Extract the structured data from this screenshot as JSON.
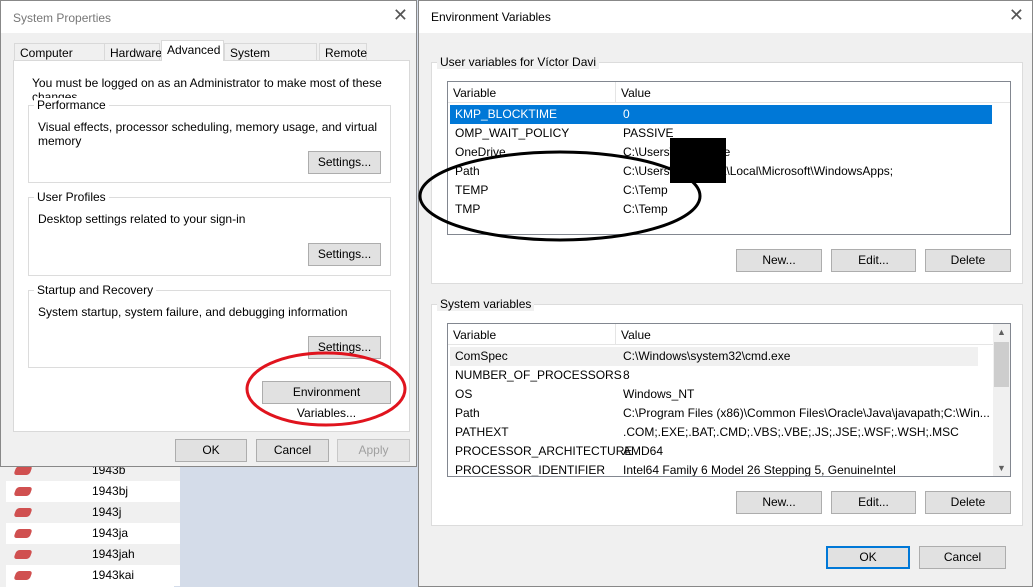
{
  "background_list": {
    "items": [
      "1943b",
      "1943bj",
      "1943j",
      "1943ja",
      "1943jah",
      "1943kai"
    ]
  },
  "system_properties": {
    "title": "System Properties",
    "tabs": [
      "Computer Name",
      "Hardware",
      "Advanced",
      "System Protection",
      "Remote"
    ],
    "active_tab": "Advanced",
    "admin_notice": "You must be logged on as an Administrator to make most of these changes.",
    "performance": {
      "label": "Performance",
      "description": "Visual effects, processor scheduling, memory usage, and virtual memory",
      "button": "Settings..."
    },
    "user_profiles": {
      "label": "User Profiles",
      "description": "Desktop settings related to your sign-in",
      "button": "Settings..."
    },
    "startup_recovery": {
      "label": "Startup and Recovery",
      "description": "System startup, system failure, and debugging information",
      "button": "Settings..."
    },
    "env_button": "Environment Variables...",
    "ok": "OK",
    "cancel": "Cancel",
    "apply": "Apply"
  },
  "env_vars": {
    "title": "Environment Variables",
    "user_label": "User variables for Víctor Davi",
    "columns": [
      "Variable",
      "Value"
    ],
    "user_rows": [
      [
        "KMP_BLOCKTIME",
        "0"
      ],
      [
        "OMP_WAIT_POLICY",
        "PASSIVE"
      ],
      [
        "OneDrive",
        "C:\\Users\\         \\OneDrive"
      ],
      [
        "Path",
        "C:\\Users\\         \\AppData\\Local\\Microsoft\\WindowsApps;"
      ],
      [
        "TEMP",
        "C:\\Temp"
      ],
      [
        "TMP",
        "C:\\Temp"
      ]
    ],
    "system_label": "System variables",
    "system_rows": [
      [
        "ComSpec",
        "C:\\Windows\\system32\\cmd.exe"
      ],
      [
        "NUMBER_OF_PROCESSORS",
        "8"
      ],
      [
        "OS",
        "Windows_NT"
      ],
      [
        "Path",
        "C:\\Program Files (x86)\\Common Files\\Oracle\\Java\\javapath;C:\\Win..."
      ],
      [
        "PATHEXT",
        ".COM;.EXE;.BAT;.CMD;.VBS;.VBE;.JS;.JSE;.WSF;.WSH;.MSC"
      ],
      [
        "PROCESSOR_ARCHITECTURE",
        "AMD64"
      ],
      [
        "PROCESSOR_IDENTIFIER",
        "Intel64 Family 6 Model 26 Stepping 5, GenuineIntel"
      ]
    ],
    "new": "New...",
    "edit": "Edit...",
    "delete": "Delete",
    "ok": "OK",
    "cancel": "Cancel"
  },
  "colors": {
    "selection": "#0078d7",
    "annotation_red": "#e0141e",
    "annotation_black": "#000000"
  }
}
